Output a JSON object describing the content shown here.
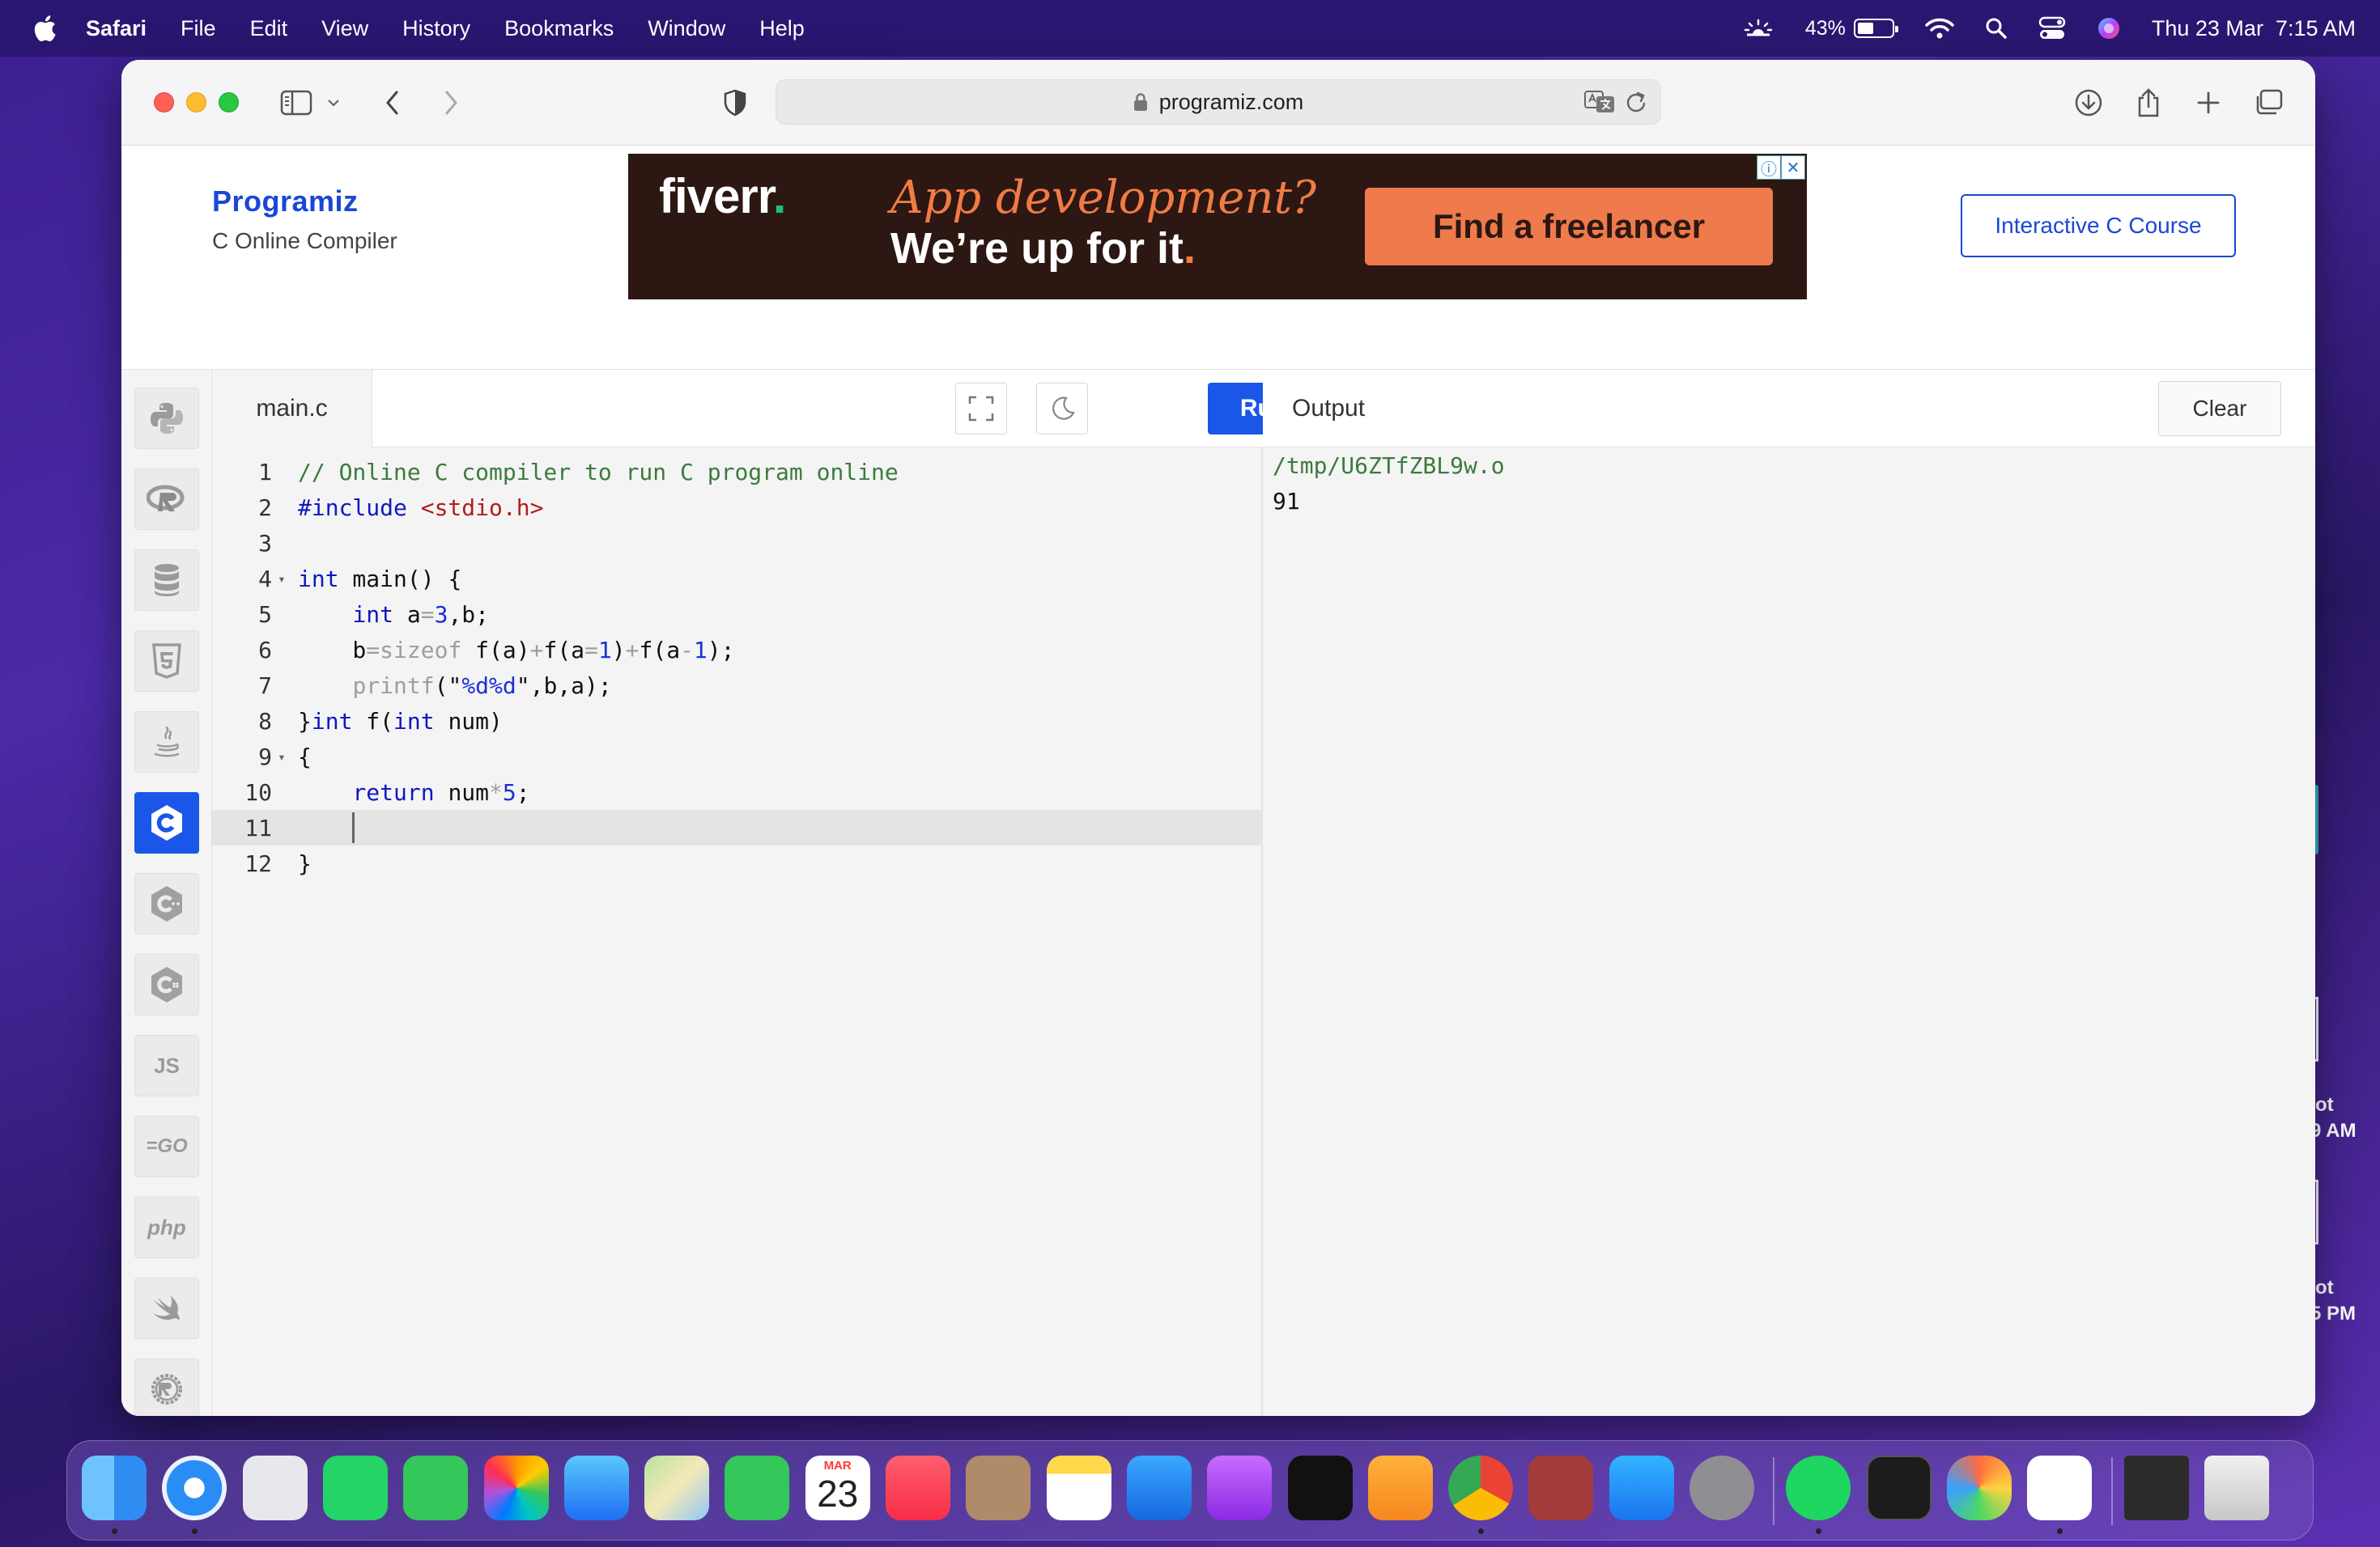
{
  "menubar": {
    "app_name": "Safari",
    "menus": [
      "File",
      "Edit",
      "View",
      "History",
      "Bookmarks",
      "Window",
      "Help"
    ],
    "battery_percent": "43%",
    "battery_level": 0.43,
    "datetime": "Thu 23 Mar  7:15 AM"
  },
  "browser": {
    "url": "programiz.com"
  },
  "header": {
    "brand_logo": "Programiz",
    "brand_sub": "C Online Compiler",
    "ad": {
      "advertiser": "fiverr",
      "headline_1": "App development?",
      "headline_2": "We’re up for it",
      "cta": "Find a freelancer"
    },
    "course_button": "Interactive C Course"
  },
  "languages": [
    {
      "name": "python",
      "label": ""
    },
    {
      "name": "r",
      "label": "R"
    },
    {
      "name": "sql",
      "label": ""
    },
    {
      "name": "html",
      "label": "5"
    },
    {
      "name": "java",
      "label": ""
    },
    {
      "name": "c",
      "label": "C",
      "active": true
    },
    {
      "name": "cpp",
      "label": "C"
    },
    {
      "name": "csharp",
      "label": "C"
    },
    {
      "name": "js",
      "label": "JS"
    },
    {
      "name": "go",
      "label": "GO"
    },
    {
      "name": "php",
      "label": "php"
    },
    {
      "name": "swift",
      "label": ""
    },
    {
      "name": "rust",
      "label": "R"
    }
  ],
  "editor": {
    "file_tab": "main.c",
    "run_label": "Run",
    "current_line": 11,
    "lines": [
      {
        "n": "1",
        "fold": false,
        "tokens": [
          [
            "c-comment",
            "// Online C compiler to run C program online"
          ]
        ]
      },
      {
        "n": "2",
        "fold": false,
        "tokens": [
          [
            "c-kw",
            "#include "
          ],
          [
            "c-str",
            "<stdio.h>"
          ]
        ]
      },
      {
        "n": "3",
        "fold": false,
        "tokens": []
      },
      {
        "n": "4",
        "fold": true,
        "tokens": [
          [
            "c-kw",
            "int"
          ],
          [
            "",
            " main() {"
          ]
        ]
      },
      {
        "n": "5",
        "fold": false,
        "tokens": [
          [
            "",
            "    "
          ],
          [
            "c-kw",
            "int"
          ],
          [
            "",
            " a"
          ],
          [
            "c-op",
            "="
          ],
          [
            "c-num",
            "3"
          ],
          [
            "",
            ",b;"
          ]
        ]
      },
      {
        "n": "6",
        "fold": false,
        "tokens": [
          [
            "",
            "    b"
          ],
          [
            "c-op",
            "=sizeof"
          ],
          [
            "",
            " f(a)"
          ],
          [
            "c-op",
            "+"
          ],
          [
            "",
            "f(a"
          ],
          [
            "c-op",
            "="
          ],
          [
            "c-num",
            "1"
          ],
          [
            "",
            ")"
          ],
          [
            "c-op",
            "+"
          ],
          [
            "",
            "f(a"
          ],
          [
            "c-op",
            "-"
          ],
          [
            "c-num",
            "1"
          ],
          [
            "",
            ");"
          ]
        ]
      },
      {
        "n": "7",
        "fold": false,
        "tokens": [
          [
            "",
            "    "
          ],
          [
            "c-op",
            "printf"
          ],
          [
            "",
            "(\""
          ],
          [
            "c-fmt",
            "%d%d"
          ],
          [
            "",
            "\",b,a);"
          ]
        ]
      },
      {
        "n": "8",
        "fold": false,
        "tokens": [
          [
            "",
            "}"
          ],
          [
            "c-kw",
            "int"
          ],
          [
            "",
            " f("
          ],
          [
            "c-kw",
            "int"
          ],
          [
            "",
            " num)"
          ]
        ]
      },
      {
        "n": "9",
        "fold": true,
        "tokens": [
          [
            "",
            "{"
          ]
        ]
      },
      {
        "n": "10",
        "fold": false,
        "tokens": [
          [
            "",
            "    "
          ],
          [
            "c-kw",
            "return"
          ],
          [
            "",
            " num"
          ],
          [
            "c-op",
            "*"
          ],
          [
            "c-num",
            "5"
          ],
          [
            "",
            ";"
          ]
        ]
      },
      {
        "n": "11",
        "fold": false,
        "tokens": [
          [
            "",
            "    "
          ]
        ],
        "caret": true
      },
      {
        "n": "12",
        "fold": false,
        "tokens": [
          [
            "",
            "}"
          ]
        ]
      }
    ]
  },
  "output": {
    "title": "Output",
    "clear_label": "Clear",
    "lines": [
      "/tmp/U6ZTfZBL9w.o",
      "91"
    ]
  },
  "desktop": {
    "labels": [
      "ot",
      "9 AM",
      "ot",
      "5 PM"
    ]
  },
  "dock": {
    "apps": [
      "finder",
      "safari",
      "launchpad",
      "whatsapp",
      "messages",
      "photos",
      "mail",
      "maps",
      "facetime",
      "calendar",
      "music",
      "contacts",
      "notes",
      "keynote",
      "podcasts",
      "apple-tv",
      "pages",
      "chrome",
      "dictionary",
      "app-store",
      "system-settings",
      "spotify",
      "terminal",
      "pinwheel",
      "vscode",
      "screenshot-preview",
      "trash"
    ],
    "calendar": {
      "month": "MAR",
      "day": "23"
    }
  }
}
